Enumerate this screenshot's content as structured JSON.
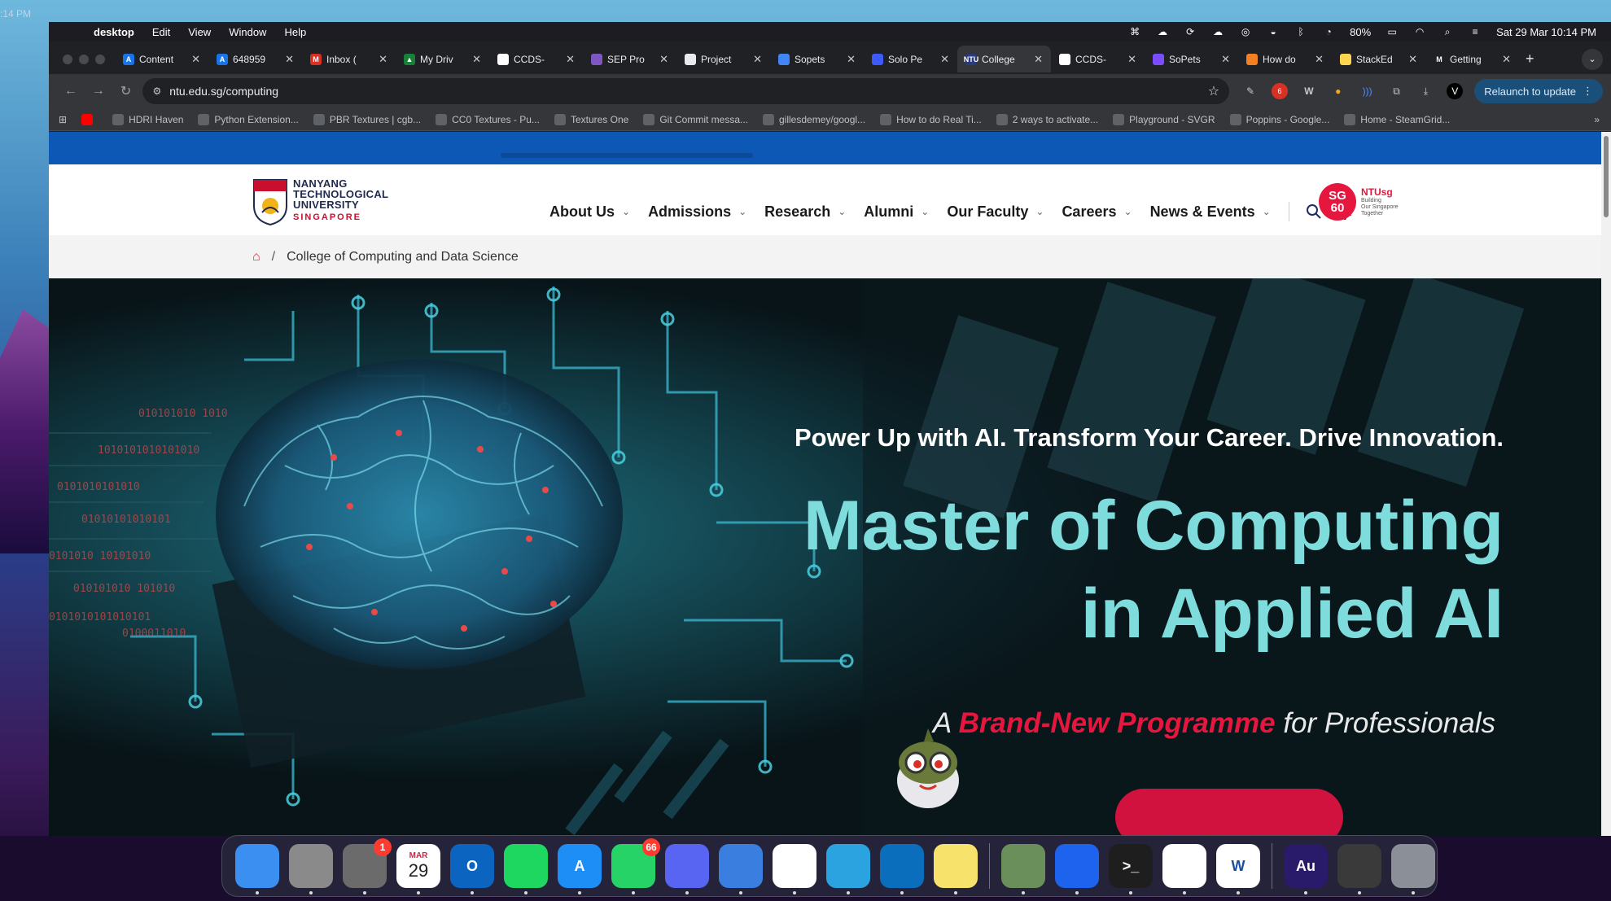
{
  "desktop": {
    "left_clock": ":14 PM"
  },
  "menubar": {
    "app_name": "desktop",
    "menus": [
      "Edit",
      "View",
      "Window",
      "Help"
    ],
    "battery": "80%",
    "datetime": "Sat 29 Mar  10:14 PM"
  },
  "tabs": [
    {
      "title": "Content",
      "fav_color": "#1a73e8",
      "fav_text": "A"
    },
    {
      "title": "648959",
      "fav_color": "#1a73e8",
      "fav_text": "A"
    },
    {
      "title": "Inbox (",
      "fav_color": "#d93025",
      "fav_text": "M"
    },
    {
      "title": "My Driv",
      "fav_color": "#188038",
      "fav_text": "▲"
    },
    {
      "title": "CCDS-",
      "fav_color": "#ffffff",
      "fav_text": ""
    },
    {
      "title": "SEP Pro",
      "fav_color": "#7e57c2",
      "fav_text": ""
    },
    {
      "title": "Project",
      "fav_color": "#e8eaed",
      "fav_text": ""
    },
    {
      "title": "Sopets",
      "fav_color": "#4285f4",
      "fav_text": ""
    },
    {
      "title": "Solo Pe",
      "fav_color": "#3d5afe",
      "fav_text": ""
    },
    {
      "title": "College",
      "fav_color": "#2a3a7a",
      "fav_text": "NTU",
      "active": true
    },
    {
      "title": "CCDS-",
      "fav_color": "#ffffff",
      "fav_text": ""
    },
    {
      "title": "SoPets",
      "fav_color": "#7c4dff",
      "fav_text": ""
    },
    {
      "title": "How do",
      "fav_color": "#f48024",
      "fav_text": ""
    },
    {
      "title": "StackEd",
      "fav_color": "#ffd54f",
      "fav_text": ""
    },
    {
      "title": "Getting",
      "fav_color": "#202124",
      "fav_text": "M"
    }
  ],
  "toolbar": {
    "url": "ntu.edu.sg/computing",
    "relaunch_label": "Relaunch to update"
  },
  "bookmarks": [
    "HDRI Haven",
    "Python Extension...",
    "PBR Textures | cgb...",
    "CC0 Textures - Pu...",
    "Textures One",
    "Git Commit messa...",
    "gillesdemey/googl...",
    "How to do Real Ti...",
    "2 ways to activate...",
    "Playground - SVGR",
    "Poppins - Google...",
    "Home - SteamGrid..."
  ],
  "site": {
    "logo_lines": [
      "NANYANG",
      "TECHNOLOGICAL",
      "UNIVERSITY"
    ],
    "logo_country": "SINGAPORE",
    "nav": [
      "About Us",
      "Admissions",
      "Research",
      "Alumni",
      "Our Faculty",
      "Careers",
      "News & Events"
    ],
    "sg60": {
      "badge_top": "SG",
      "badge_bottom": "60",
      "brand": "NTUsg",
      "tag_lines": [
        "Building",
        "Our Singapore",
        "Together"
      ]
    },
    "breadcrumb_sep": "/",
    "breadcrumb": "College of Computing and Data Science",
    "hero": {
      "tagline": "Power Up with AI. Transform Your Career. Drive Innovation.",
      "title_line1": "Master of Computing",
      "title_line2": "in Applied AI",
      "sub_prefix": "A ",
      "sub_brand": "Brand-New Programme",
      "sub_suffix": " for Professionals"
    },
    "colors": {
      "brand_red": "#e5173f",
      "ntu_blue": "#0d58b5",
      "hero_teal": "#7fdcdc"
    }
  },
  "dock": {
    "apps": [
      {
        "name": "finder-app",
        "label": "",
        "color": "#3b8ff0"
      },
      {
        "name": "launchpad-app",
        "label": "",
        "color": "#8a8a8a"
      },
      {
        "name": "system-settings-app",
        "label": "",
        "color": "#6b6b6b",
        "badge": "1"
      },
      {
        "name": "calendar-app",
        "label": "29",
        "color": "#ffffff",
        "month": "MAR"
      },
      {
        "name": "outlook-app",
        "label": "O",
        "color": "#0a64c0"
      },
      {
        "name": "spotify-app",
        "label": "",
        "color": "#1ed760"
      },
      {
        "name": "app-store-app",
        "label": "A",
        "color": "#1d8ef5"
      },
      {
        "name": "whatsapp-app",
        "label": "",
        "color": "#25d366",
        "badge": "66"
      },
      {
        "name": "discord-app",
        "label": "",
        "color": "#5865f2"
      },
      {
        "name": "xcode-app",
        "label": "",
        "color": "#3a7fe0"
      },
      {
        "name": "chrome-app",
        "label": "",
        "color": "#ffffff"
      },
      {
        "name": "telegram-app",
        "label": "",
        "color": "#2aa3e0"
      },
      {
        "name": "vscode-app",
        "label": "",
        "color": "#0a6ebd"
      },
      {
        "name": "notes-app",
        "label": "",
        "color": "#f7e36b"
      },
      {
        "name": "sourcetree-app",
        "label": "",
        "color": "#6a8f5a"
      },
      {
        "name": "docker-app",
        "label": "",
        "color": "#1d63ed"
      },
      {
        "name": "terminal-app",
        "label": ">_",
        "color": "#1e1e1e"
      },
      {
        "name": "flutter-app",
        "label": "",
        "color": "#ffffff"
      },
      {
        "name": "word-app",
        "label": "W",
        "color": "#ffffff"
      },
      {
        "name": "audition-app",
        "label": "Au",
        "color": "#2a1a6a"
      },
      {
        "name": "recent-window",
        "label": "",
        "color": "#3a3a3a"
      },
      {
        "name": "trash-app",
        "label": "",
        "color": "#8a8f98"
      }
    ]
  }
}
